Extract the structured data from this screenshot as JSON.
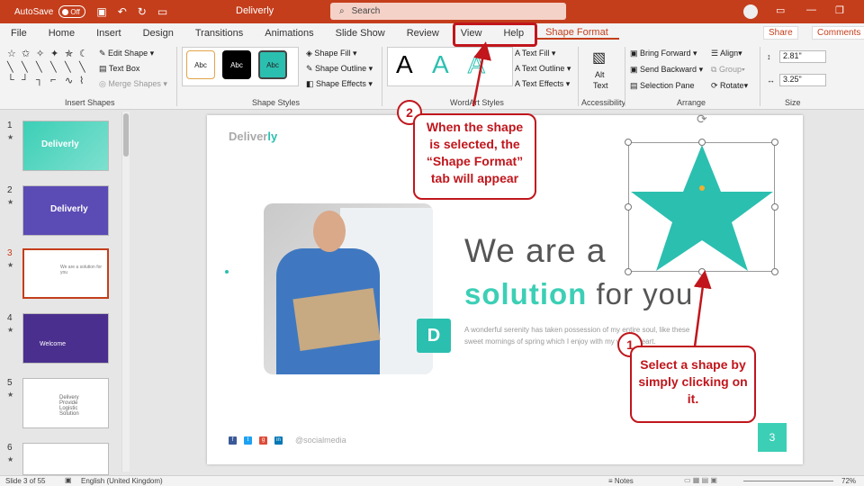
{
  "titlebar": {
    "autosave_label": "AutoSave",
    "autosave_state": "Off",
    "doc_title": "Deliverly",
    "search_placeholder": "Search"
  },
  "tabs": [
    "File",
    "Home",
    "Insert",
    "Design",
    "Transitions",
    "Animations",
    "Slide Show",
    "Review",
    "View",
    "Help",
    "Shape Format"
  ],
  "active_tab": "Shape Format",
  "share_label": "Share",
  "comments_label": "Comments",
  "ribbon": {
    "insert_shapes": {
      "label": "Insert Shapes",
      "edit_shape": "Edit Shape",
      "text_box": "Text Box",
      "merge_shapes": "Merge Shapes"
    },
    "shape_styles": {
      "label": "Shape Styles",
      "swatches": [
        "Abc",
        "Abc",
        "Abc"
      ],
      "shape_fill": "Shape Fill",
      "shape_outline": "Shape Outline",
      "shape_effects": "Shape Effects"
    },
    "wordart": {
      "label": "WordArt Styles",
      "letters": [
        "A",
        "A",
        "A"
      ],
      "text_fill": "Text Fill",
      "text_outline": "Text Outline",
      "text_effects": "Text Effects"
    },
    "accessibility": {
      "label": "Accessibility",
      "alt_text_1": "Alt",
      "alt_text_2": "Text"
    },
    "arrange": {
      "label": "Arrange",
      "bring_forward": "Bring Forward",
      "send_backward": "Send Backward",
      "selection_pane": "Selection Pane",
      "align": "Align",
      "group": "Group",
      "rotate": "Rotate"
    },
    "size": {
      "label": "Size",
      "height": "2.81\"",
      "width": "3.25\""
    }
  },
  "thumbnails": [
    {
      "num": "1",
      "title": "Deliverly"
    },
    {
      "num": "2",
      "title": "Deliverly"
    },
    {
      "num": "3",
      "title": "We are a solution for you"
    },
    {
      "num": "4",
      "title": "Welcome"
    },
    {
      "num": "5",
      "title": "Delivery Provide Logistic Solution"
    },
    {
      "num": "6",
      "title": ""
    }
  ],
  "slide": {
    "logo_main": "Deliver",
    "logo_accent": "ly",
    "badge_letter": "D",
    "heading_line1": "We are a",
    "heading_accent": "solution",
    "heading_rest": " for you",
    "body_text": "A wonderful serenity has taken possession of my entire soul, like these sweet mornings of spring which I enjoy with my whole heart.",
    "social_text": "@socialmedia",
    "page_number": "3"
  },
  "callouts": {
    "step2_num": "2",
    "step2_text": "When the shape is selected, the “Shape Format” tab will appear",
    "step1_num": "1",
    "step1_text": "Select a shape by simply clicking on it."
  },
  "statusbar": {
    "slide_info": "Slide 3 of 55",
    "language": "English (United Kingdom)",
    "notes": "Notes",
    "zoom": "72%"
  },
  "colors": {
    "accent": "#c43e1c",
    "teal": "#2bbfb0",
    "callout": "#c0161c"
  }
}
